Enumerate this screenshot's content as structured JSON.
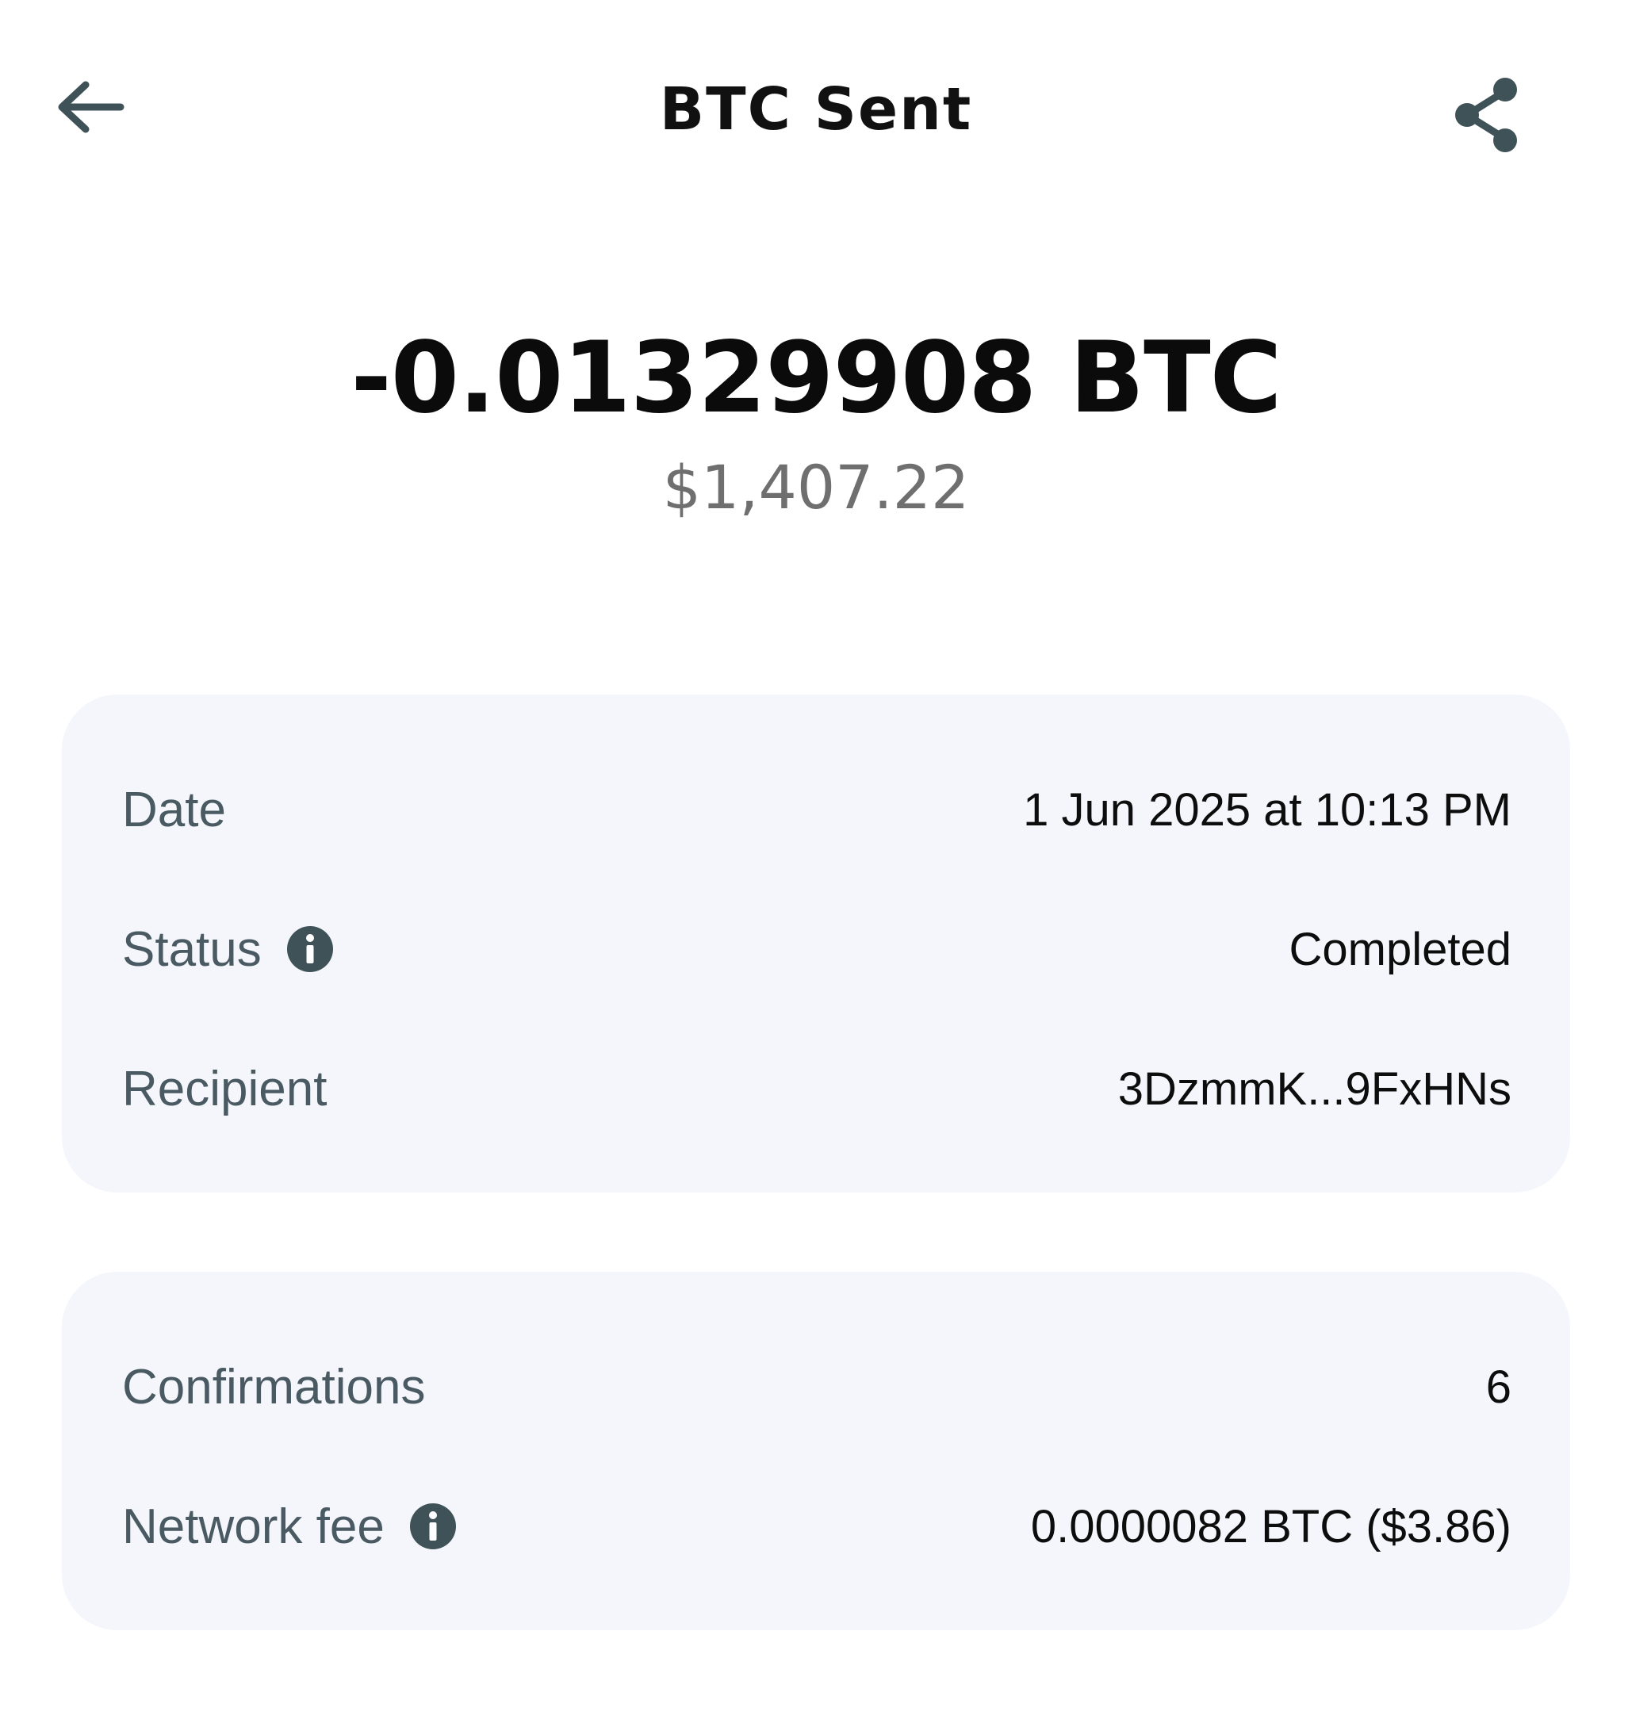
{
  "header": {
    "title": "BTC Sent",
    "back_icon": "arrow-left-icon",
    "share_icon": "share-icon"
  },
  "summary": {
    "amount": "-0.01329908 BTC",
    "fiat": "$1,407.22"
  },
  "details_card": {
    "rows": [
      {
        "label": "Date",
        "value": "1 Jun 2025  at 10:13 PM"
      },
      {
        "label": "Status",
        "value": "Completed",
        "info_icon": "info-icon"
      },
      {
        "label": "Recipient",
        "value": "3DzmmK...9FxHNs"
      }
    ]
  },
  "network_card": {
    "rows": [
      {
        "label": "Confirmations",
        "value": "6"
      },
      {
        "label": "Network fee",
        "value": "0.0000082 BTC ($3.86)",
        "info_icon": "info-icon"
      }
    ]
  },
  "colors": {
    "icon": "#3f5257",
    "card_background": "#f5f6fc",
    "label": "#4a5a62",
    "fiat": "#6f6f6f"
  }
}
